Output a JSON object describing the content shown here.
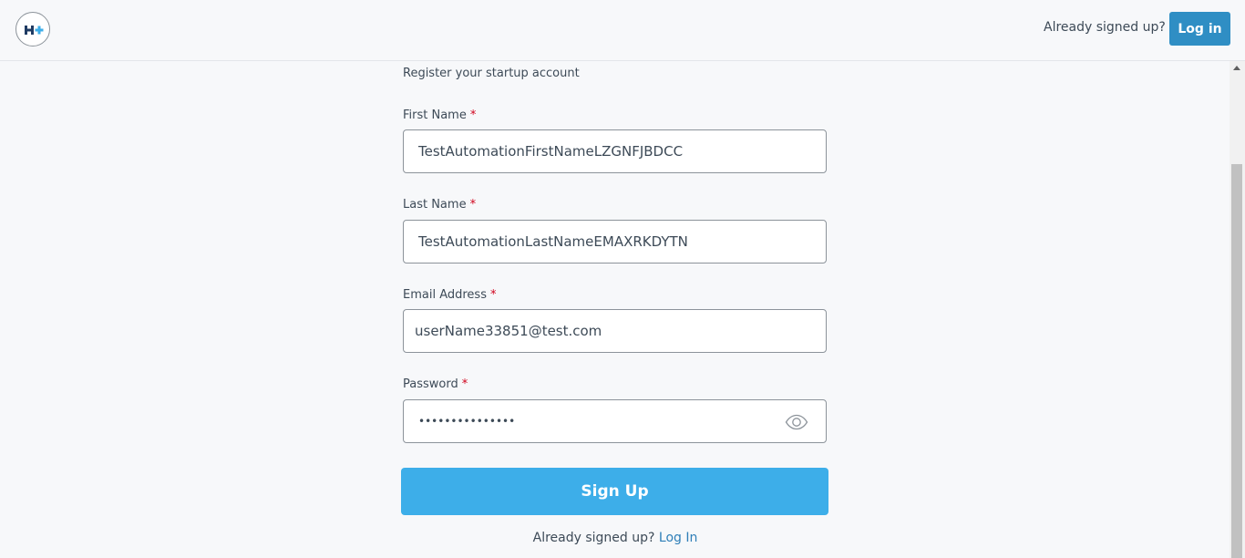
{
  "header": {
    "logo_text": "H+",
    "prompt": "Already signed up?",
    "login_label": "Log in"
  },
  "form": {
    "subtitle": "Register your startup account",
    "required_mark": "*",
    "first_name": {
      "label": "First Name",
      "value": "TestAutomationFirstNameLZGNFJBDCC"
    },
    "last_name": {
      "label": "Last Name",
      "value": "TestAutomationLastNameEMAXRKDYTN"
    },
    "email": {
      "label": "Email Address",
      "value": "userName33851@test.com"
    },
    "password": {
      "label": "Password",
      "value": "•••••••••••••••",
      "toggle_icon": "eye-icon"
    },
    "submit_label": "Sign Up"
  },
  "footer": {
    "prompt": "Already signed up?",
    "link_label": "Log In"
  },
  "colors": {
    "primary_button": "#3daee9",
    "header_button": "#2f8ec4",
    "link": "#2f7fb8",
    "required": "#d0021b",
    "logo_dark": "#1f3b63",
    "logo_accent": "#3daee9"
  }
}
